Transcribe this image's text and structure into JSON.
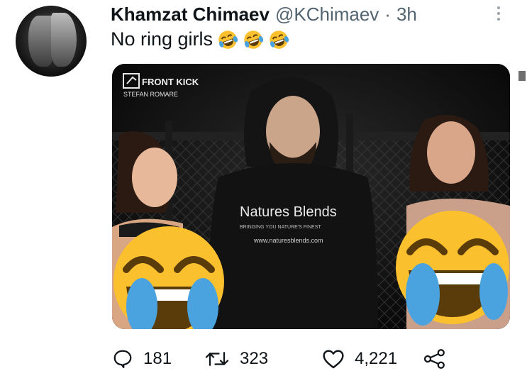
{
  "tweet": {
    "display_name": "Khamzat Chimaev",
    "handle": "@KChimaev",
    "separator": "·",
    "time": "3h",
    "text": "No ring girls",
    "text_emojis": [
      "face-with-tears-of-joy",
      "face-with-tears-of-joy",
      "face-with-tears-of-joy"
    ]
  },
  "media": {
    "watermark_brand": "FRONT KICK",
    "watermark_credit": "STEFAN ROMARE",
    "hoodie_brand": "Natures Blends",
    "hoodie_tagline": "BRINGING YOU NATURE'S FINEST",
    "hoodie_url": "www.naturesblends.com",
    "censor_emoji": "face-with-tears-of-joy"
  },
  "actions": {
    "replies": "181",
    "retweets": "323",
    "likes": "4,221"
  },
  "icons": {
    "more": "more-vertical-icon",
    "reply": "speech-bubble-icon",
    "retweet": "retweet-icon",
    "like": "heart-icon",
    "share": "share-icon"
  },
  "colors": {
    "text": "#0f1419",
    "secondary": "#536471",
    "emoji_yellow": "#fbc02d"
  }
}
